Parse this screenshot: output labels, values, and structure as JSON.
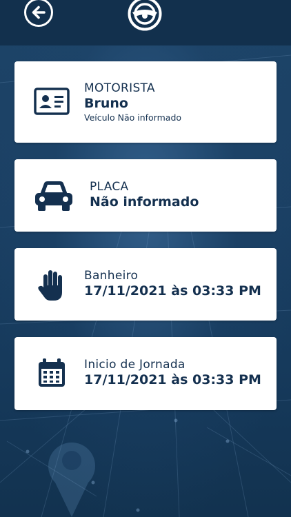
{
  "header": {
    "back_icon": "arrow-left-circle-icon",
    "steering_icon": "steering-wheel-icon"
  },
  "cards": {
    "motorista": {
      "icon": "id-card-icon",
      "label": "MOTORISTA",
      "value": "Bruno",
      "sub": "Veículo Não informado"
    },
    "placa": {
      "icon": "car-icon",
      "label": "PLACA",
      "value": "Não informado"
    },
    "banheiro": {
      "icon": "hand-icon",
      "label": "Banheiro",
      "value": "17/11/2021 às 03:33 PM"
    },
    "jornada": {
      "icon": "calendar-icon",
      "label": "Inicio de Jornada",
      "value": "17/11/2021 às 03:33 PM"
    }
  },
  "colors": {
    "background": "#1b4064",
    "topbar": "#12304d",
    "card": "#ffffff",
    "text": "#14304f"
  }
}
